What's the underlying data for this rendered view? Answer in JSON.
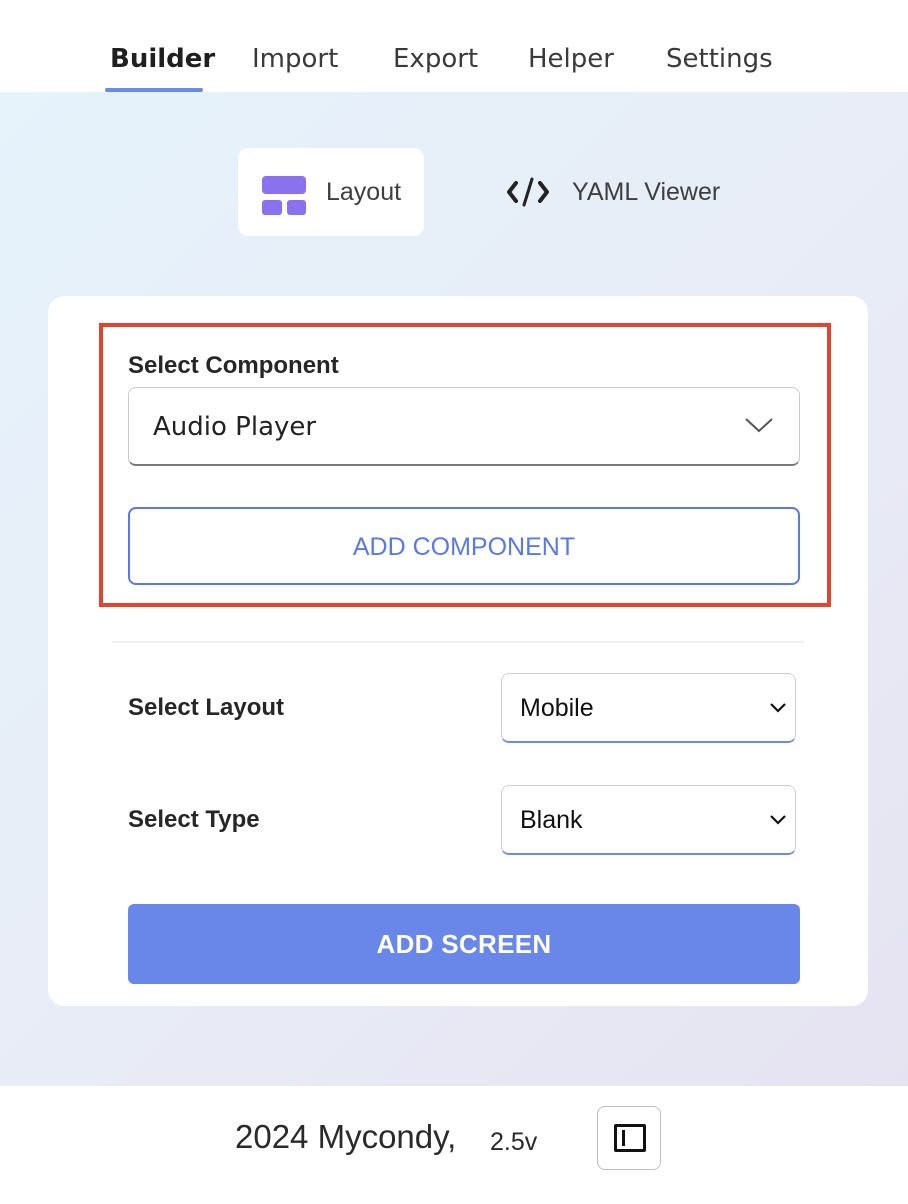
{
  "tabs": [
    {
      "label": "Builder",
      "active": true
    },
    {
      "label": "Import",
      "active": false
    },
    {
      "label": "Export",
      "active": false
    },
    {
      "label": "Helper",
      "active": false
    },
    {
      "label": "Settings",
      "active": false
    }
  ],
  "view_toggle": {
    "layout_label": "Layout",
    "layout_icon": "layout-icon",
    "yaml_label": "YAML Viewer",
    "yaml_icon": "code-icon"
  },
  "component_section": {
    "label": "Select Component",
    "selected": "Audio Player",
    "add_button": "ADD COMPONENT"
  },
  "layout_section": {
    "label": "Select Layout",
    "selected": "Mobile"
  },
  "type_section": {
    "label": "Select Type",
    "selected": "Blank"
  },
  "add_screen_button": "ADD SCREEN",
  "footer": {
    "copyright": "2024 Mycondy,",
    "version": "2.5v",
    "sidebar_icon": "sidebar-toggle-icon"
  },
  "colors": {
    "accent": "#6987e8",
    "icon_purple": "#8a72ef",
    "highlight_border": "#e0452e"
  }
}
